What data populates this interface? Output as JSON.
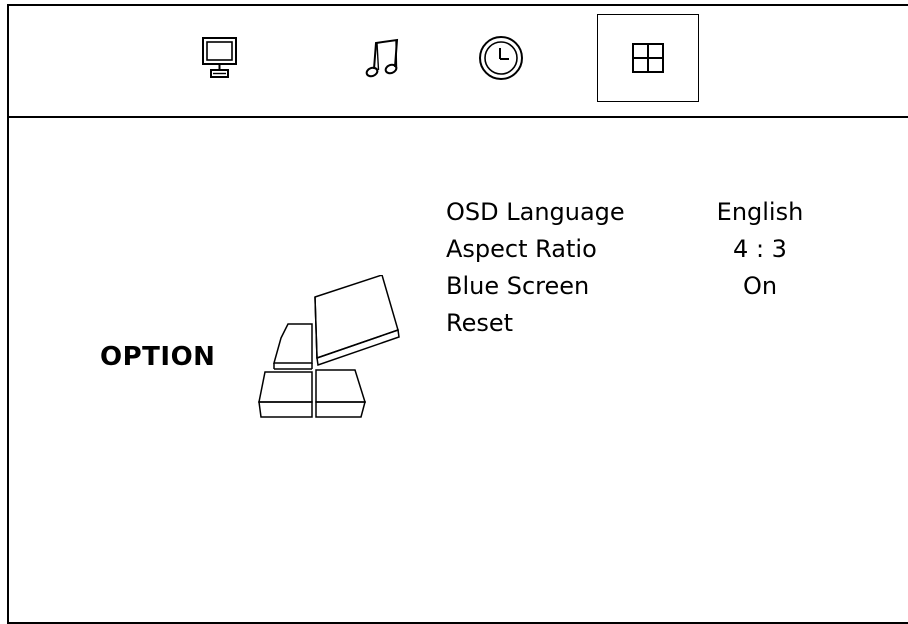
{
  "header": {
    "tabs": [
      {
        "icon": "monitor-icon",
        "selected": false
      },
      {
        "icon": "music-note-icon",
        "selected": false
      },
      {
        "icon": "clock-icon",
        "selected": false
      },
      {
        "icon": "grid-icon",
        "selected": true
      }
    ]
  },
  "main": {
    "title": "OPTION",
    "illustration_icon": "option-blocks-icon",
    "items": [
      {
        "label": "OSD Language",
        "value": "English"
      },
      {
        "label": "Aspect Ratio",
        "value": "4 : 3"
      },
      {
        "label": "Blue Screen",
        "value": "On"
      },
      {
        "label": "Reset",
        "value": ""
      }
    ]
  }
}
